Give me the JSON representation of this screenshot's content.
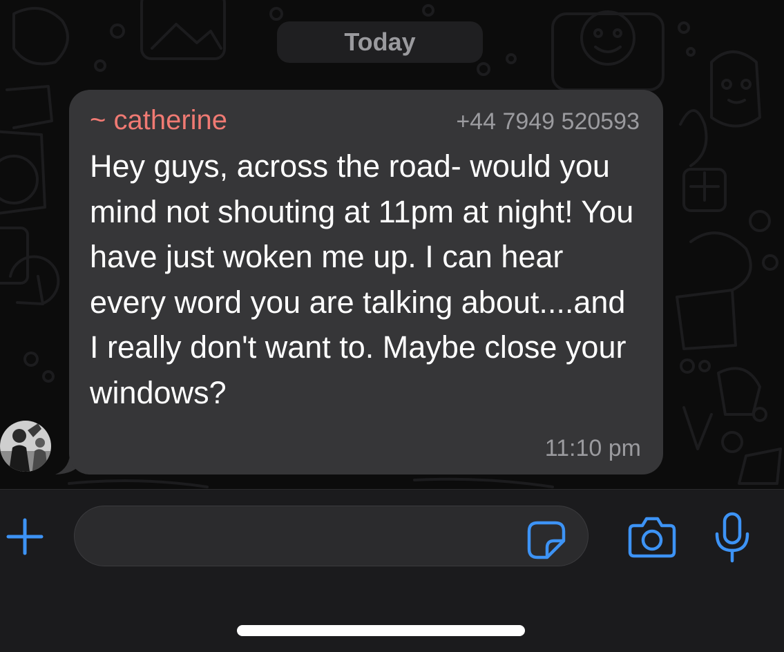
{
  "date_divider": {
    "label": "Today"
  },
  "message": {
    "sender_name": "~ catherine",
    "sender_phone": "+44 7949 520593",
    "text": "Hey guys, across the road- would you mind not shouting at 11pm at night! You have just woken me up. I can hear every word you are talking about....and I really don't want to. Maybe close your windows?",
    "time": "11:10 pm"
  },
  "composer": {
    "input_value": "",
    "placeholder": "",
    "icons": {
      "add": "plus-icon",
      "sticker": "sticker-icon",
      "camera": "camera-icon",
      "microphone": "microphone-icon"
    }
  },
  "colors": {
    "accent": "#3d93f5",
    "sender_name": "#f07a73",
    "bubble": "#363638",
    "background": "#0c0c0c"
  }
}
